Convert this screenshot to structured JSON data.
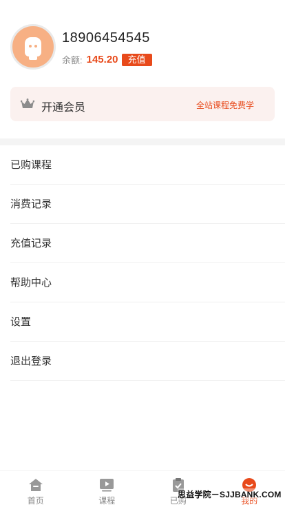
{
  "profile": {
    "phone": "18906454545",
    "balance_label": "余额:",
    "balance_value": "145.20",
    "recharge_label": "充值"
  },
  "vip": {
    "label": "开通会员",
    "tag": "全站课程免费学"
  },
  "menu": {
    "items": [
      {
        "label": "已购课程"
      },
      {
        "label": "消费记录"
      },
      {
        "label": "充值记录"
      },
      {
        "label": "帮助中心"
      },
      {
        "label": "设置"
      },
      {
        "label": "退出登录"
      }
    ]
  },
  "tabbar": {
    "items": [
      {
        "label": "首页",
        "icon": "home-icon",
        "active": false
      },
      {
        "label": "课程",
        "icon": "play-icon",
        "active": false
      },
      {
        "label": "已购",
        "icon": "clipboard-check-icon",
        "active": false
      },
      {
        "label": "我的",
        "icon": "user-icon",
        "active": true
      }
    ]
  },
  "watermark": "思益学院－SJJBANK.COM",
  "colors": {
    "accent": "#e84a1b",
    "vip_bg": "#fbf1ef",
    "avatar_bg": "#f7b084",
    "icon_gray": "#999999"
  }
}
